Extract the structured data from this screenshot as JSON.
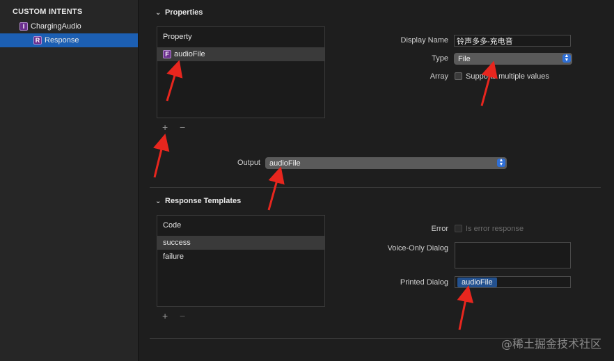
{
  "sidebar": {
    "header": "CUSTOM INTENTS",
    "items": [
      {
        "badge": "I",
        "label": "ChargingAudio",
        "selected": false
      },
      {
        "badge": "R",
        "label": "Response",
        "selected": true
      }
    ]
  },
  "properties": {
    "title": "Properties",
    "list_header": "Property",
    "items": [
      {
        "badge": "F",
        "label": "audioFile"
      }
    ],
    "add_symbol": "+",
    "remove_symbol": "−",
    "display_name_label": "Display Name",
    "display_name_value": "铃声多多-充电音",
    "type_label": "Type",
    "type_value": "File",
    "array_label": "Array",
    "array_checkbox_label": "Supports multiple values",
    "output_label": "Output",
    "output_value": "audioFile"
  },
  "templates": {
    "title": "Response Templates",
    "list_header": "Code",
    "items": [
      {
        "label": "success",
        "selected": true
      },
      {
        "label": "failure",
        "selected": false
      }
    ],
    "add_symbol": "+",
    "remove_symbol": "−",
    "error_label": "Error",
    "error_checkbox_label": "Is error response",
    "voice_only_label": "Voice-Only Dialog",
    "printed_dialog_label": "Printed Dialog",
    "printed_dialog_token": "audioFile"
  },
  "watermark": "@稀土掘金技术社区",
  "colors": {
    "selection": "#1c5fb3",
    "badge": "#6b2f8e",
    "annotation_arrow": "#e8261e",
    "token": "#23518f"
  }
}
